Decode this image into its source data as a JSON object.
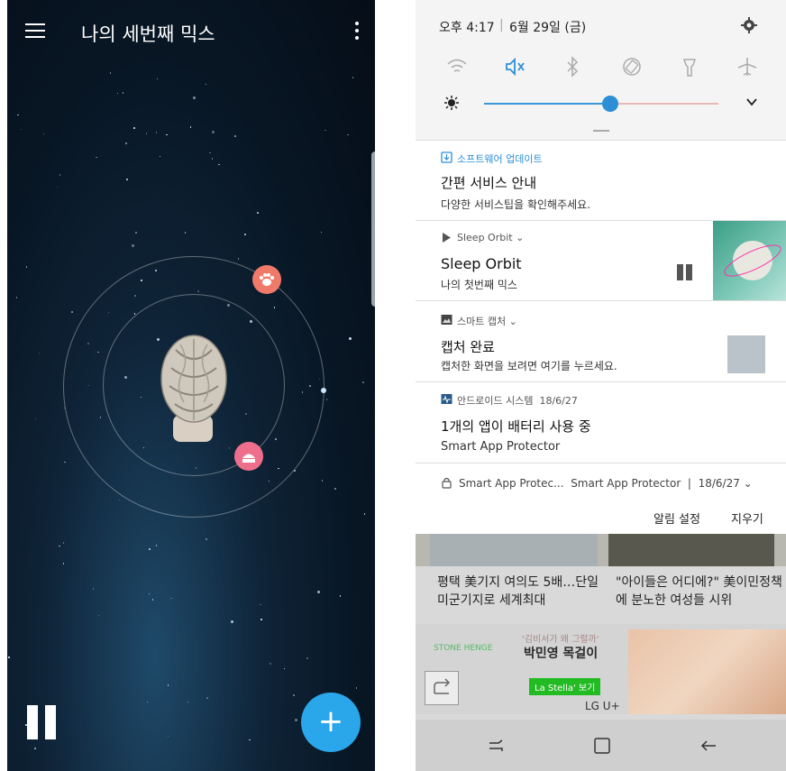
{
  "left_app": {
    "title": "나의 세번째 믹스",
    "menu_icon": "hamburger-menu-icon",
    "more_icon": "more-vert-icon",
    "orbit_items": [
      {
        "icon": "paw-icon",
        "color": "#f07a6a"
      },
      {
        "icon": "cake-icon",
        "color": "#ee6f8c"
      }
    ],
    "center_figure": "braided-hair-head",
    "pause_icon": "pause-icon",
    "fab_label": "+",
    "fab_color": "#29a7ea"
  },
  "status": {
    "time": "오후 4:17",
    "date": "6월 29일 (금)"
  },
  "quick_settings": {
    "icons": [
      "wifi-icon",
      "sound-mute-icon",
      "bluetooth-icon",
      "auto-rotate-icon",
      "flashlight-icon",
      "airplane-mode-icon"
    ],
    "brightness_level": 0.6
  },
  "notifications": [
    {
      "app": "소프트웨어 업데이트",
      "title": "간편 서비스 안내",
      "text": "다양한 서비스팁을 확인해주세요."
    },
    {
      "app": "Sleep Orbit",
      "title": "Sleep Orbit",
      "text": "나의 첫번째 믹스"
    },
    {
      "app": "스마트 캡처",
      "title": "캡처 완료",
      "text": "캡처한 화면을 보려면 여기를 누르세요."
    },
    {
      "app": "안드로이드 시스템",
      "app_time": "18/6/27",
      "title": "1개의 앱이 배터리 사용 중",
      "text": "Smart App Protector"
    }
  ],
  "footer_notification": {
    "app": "Smart App Protec...",
    "text": "Smart App Protector",
    "sep": "|",
    "date": "18/6/27"
  },
  "actions": {
    "settings": "알림 설정",
    "clear": "지우기"
  },
  "news": {
    "item_a": "평택 美기지 여의도 5배…단일 미군기지로 세계최대",
    "item_b": "\"아이들은 어디에?\" 美이민정책에 분노한 여성들 시위"
  },
  "ad": {
    "stone": "STONE HENGE",
    "sub": "'김비서가 왜 그럴까'",
    "title": "박민영 목걸이",
    "button": "La Stella' 보기"
  },
  "carrier": "LG U+",
  "nav_icons": [
    "recent-apps-icon",
    "home-icon",
    "back-icon"
  ]
}
